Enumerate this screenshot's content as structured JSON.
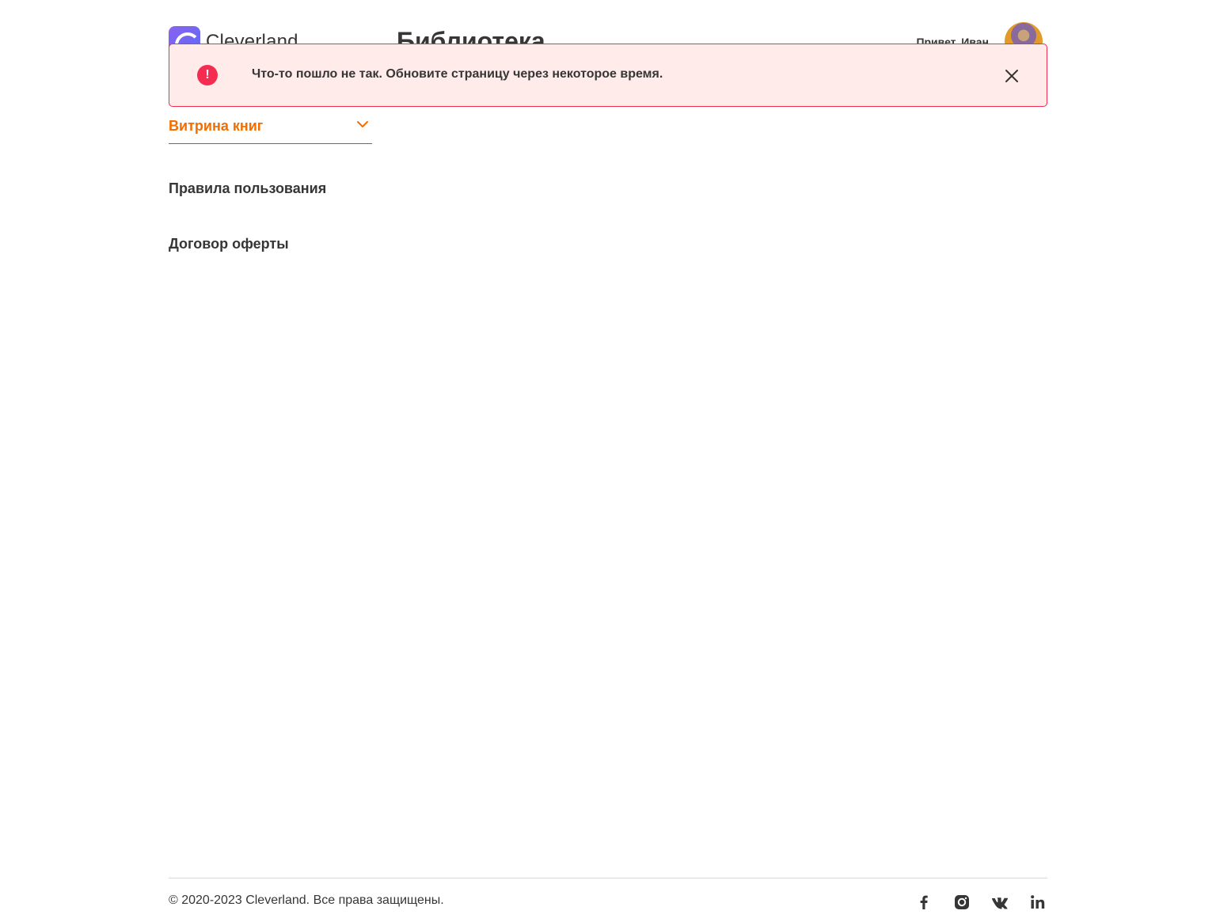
{
  "header": {
    "logo_text": "Cleverland",
    "title": "Библиотека",
    "greeting": "Привет, Иван"
  },
  "toast": {
    "message": "Что-то пошло не так. Обновите страницу через некоторое время.",
    "icon": "!",
    "accent_color": "#f42c4f",
    "background_color": "#feebea"
  },
  "nav": {
    "showcase_label": "Витрина книг",
    "rules_label": "Правила пользования",
    "offer_label": "Договор оферты",
    "active_color": "#f46d00"
  },
  "footer": {
    "copyright": "© 2020-2023 Cleverland. Все права защищены.",
    "socials": [
      "facebook-icon",
      "instagram-icon",
      "vk-icon",
      "linkedin-icon"
    ]
  }
}
